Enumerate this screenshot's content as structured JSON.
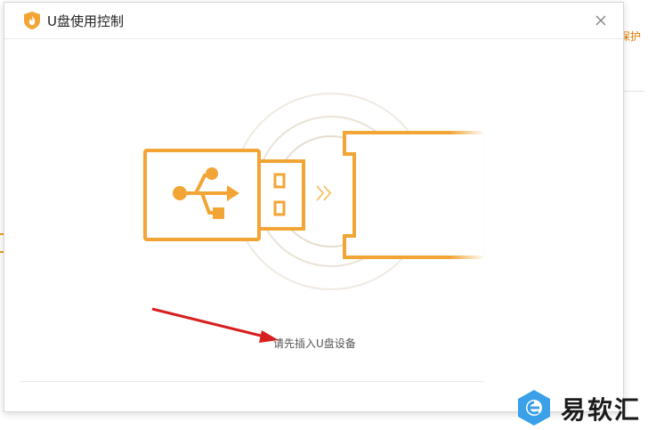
{
  "background": {
    "right_label": "保护"
  },
  "dialog": {
    "title": "U盘使用控制",
    "close_icon": "close-icon",
    "logo_icon": "shield-flame-logo",
    "hint": "请先插入U盘设备"
  },
  "colors": {
    "accent": "#f2a534",
    "accent_light": "#f6c66f",
    "arrow_red": "#d81e1e",
    "ring": "#e8e0d4"
  },
  "watermark": {
    "text": "易软汇",
    "icon": "logo-mark"
  }
}
